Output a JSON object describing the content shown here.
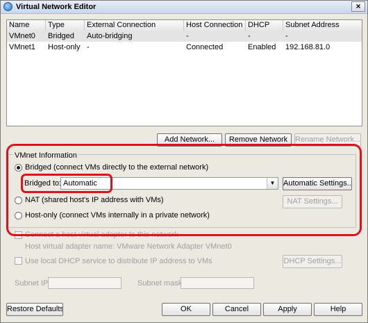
{
  "window": {
    "title": "Virtual Network Editor",
    "close_glyph": "×"
  },
  "table": {
    "columns": [
      "Name",
      "Type",
      "External Connection",
      "Host Connection",
      "DHCP",
      "Subnet Address"
    ],
    "rows": [
      [
        "VMnet0",
        "Bridged",
        "Auto-bridging",
        "-",
        "-",
        "-"
      ],
      [
        "VMnet1",
        "Host-only",
        "-",
        "Connected",
        "Enabled",
        "192.168.81.0"
      ]
    ]
  },
  "table_buttons": {
    "add": "Add Network...",
    "remove": "Remove Network",
    "rename": "Rename Network..."
  },
  "vmnet_info": {
    "group_label": "VMnet Information",
    "bridged_label": "Bridged (connect VMs directly to the external network)",
    "bridged_to_label": "Bridged to:",
    "bridged_to_value": "Automatic",
    "auto_settings": "Automatic Settings...",
    "nat_label": "NAT (shared host's IP address with VMs)",
    "nat_settings": "NAT Settings...",
    "hostonly_label": "Host-only (connect VMs internally in a private network)"
  },
  "connect_adapter": {
    "label": "Connect a host virtual adapter to this network",
    "adapter_name": "Host virtual adapter name: VMware Network Adapter VMnet0"
  },
  "dhcp": {
    "label": "Use local DHCP service to distribute IP address to VMs",
    "settings": "DHCP Settings..."
  },
  "subnet": {
    "ip_label": "Subnet IP:",
    "mask_label": "Subnet mask:"
  },
  "footer": {
    "restore": "Restore Defaults",
    "ok": "OK",
    "cancel": "Cancel",
    "apply": "Apply",
    "help": "Help"
  },
  "colors": {
    "annotation": "#e0101c"
  },
  "icons": {
    "title": "network-globe-icon",
    "close": "close-icon",
    "dropdown": "chevron-down-icon"
  }
}
